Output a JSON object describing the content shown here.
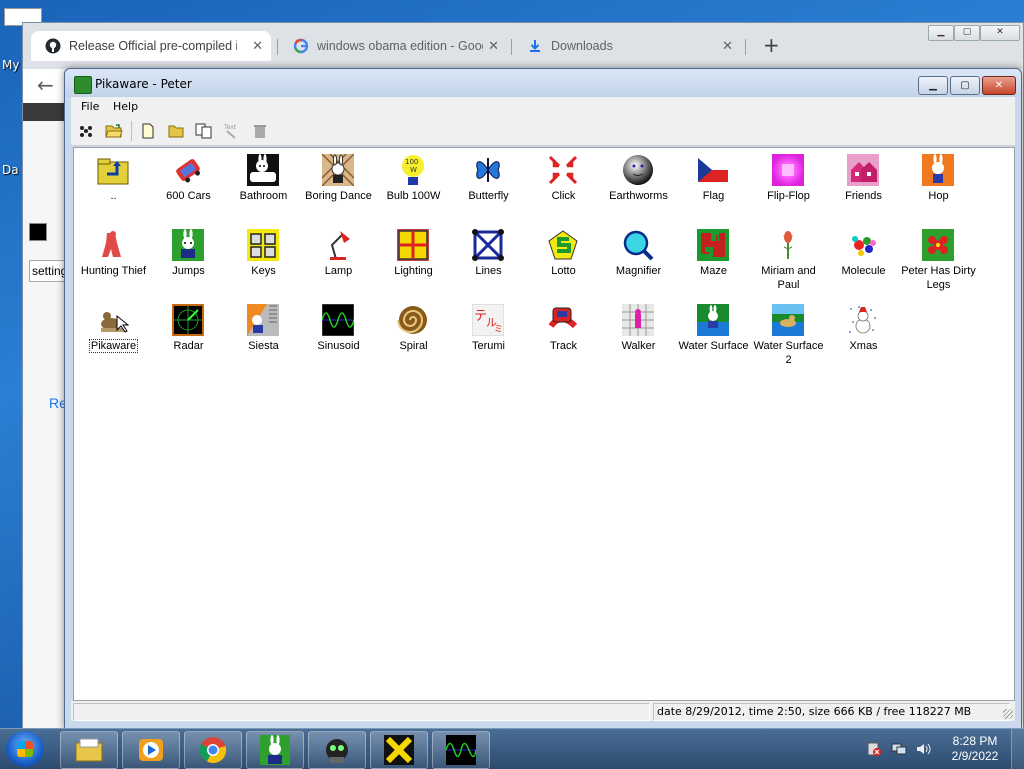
{
  "desktop": {
    "label_my": "My",
    "label_da": "Da"
  },
  "chrome": {
    "tabs": [
      {
        "title": "Release Official pre-compiled ins",
        "icon": "github-icon",
        "active": true
      },
      {
        "title": "windows obama edition - Google",
        "icon": "google-icon",
        "active": false
      },
      {
        "title": "Downloads",
        "icon": "download-icon",
        "active": false
      }
    ],
    "behind_input_value": "setting",
    "behind_link_text": "Re"
  },
  "pikaware": {
    "window_title": "Pikaware - Peter",
    "menu": [
      "File",
      "Help"
    ],
    "toolbar": [
      {
        "name": "multimedia-icon",
        "enabled": true
      },
      {
        "name": "open-folder-icon",
        "enabled": true
      },
      {
        "name": "new-file-icon",
        "enabled": true
      },
      {
        "name": "new-folder-icon",
        "enabled": true
      },
      {
        "name": "copy-icon",
        "enabled": true
      },
      {
        "name": "text-tool-icon",
        "enabled": false
      },
      {
        "name": "delete-icon",
        "enabled": false
      }
    ],
    "items": [
      {
        "label": "..",
        "icon": "parent-folder-icon"
      },
      {
        "label": "600 Cars",
        "icon": "cars-icon"
      },
      {
        "label": "Bathroom",
        "icon": "bathroom-icon"
      },
      {
        "label": "Boring Dance",
        "icon": "boring-dance-icon"
      },
      {
        "label": "Bulb 100W",
        "icon": "bulb-icon"
      },
      {
        "label": "Butterfly",
        "icon": "butterfly-icon"
      },
      {
        "label": "Click",
        "icon": "click-icon"
      },
      {
        "label": "Earthworms",
        "icon": "earthworms-icon"
      },
      {
        "label": "Flag",
        "icon": "flag-icon"
      },
      {
        "label": "Flip-Flop",
        "icon": "flip-flop-icon"
      },
      {
        "label": "Friends",
        "icon": "friends-icon"
      },
      {
        "label": "Hop",
        "icon": "hop-icon"
      },
      {
        "label": "Hunting Thief",
        "icon": "hunting-thief-icon"
      },
      {
        "label": "Jumps",
        "icon": "jumps-icon"
      },
      {
        "label": "Keys",
        "icon": "keys-icon"
      },
      {
        "label": "Lamp",
        "icon": "lamp-icon"
      },
      {
        "label": "Lighting",
        "icon": "lighting-icon"
      },
      {
        "label": "Lines",
        "icon": "lines-icon"
      },
      {
        "label": "Lotto",
        "icon": "lotto-icon"
      },
      {
        "label": "Magnifier",
        "icon": "magnifier-icon"
      },
      {
        "label": "Maze",
        "icon": "maze-icon"
      },
      {
        "label": "Miriam and Paul",
        "icon": "miriam-paul-icon"
      },
      {
        "label": "Molecule",
        "icon": "molecule-icon"
      },
      {
        "label": "Peter Has Dirty Legs",
        "icon": "peter-dirty-legs-icon"
      },
      {
        "label": "Pikaware",
        "icon": "pikaware-icon",
        "selected": true
      },
      {
        "label": "Radar",
        "icon": "radar-icon"
      },
      {
        "label": "Siesta",
        "icon": "siesta-icon"
      },
      {
        "label": "Sinusoid",
        "icon": "sinusoid-icon"
      },
      {
        "label": "Spiral",
        "icon": "spiral-icon"
      },
      {
        "label": "Terumi",
        "icon": "terumi-icon"
      },
      {
        "label": "Track",
        "icon": "track-icon"
      },
      {
        "label": "Walker",
        "icon": "walker-icon"
      },
      {
        "label": "Water Surface",
        "icon": "water-surface-icon"
      },
      {
        "label": "Water Surface 2",
        "icon": "water-surface-2-icon"
      },
      {
        "label": "Xmas",
        "icon": "xmas-icon"
      }
    ],
    "status": "date 8/29/2012, time 2:50, size 666 KB / free 118227 MB"
  },
  "taskbar": {
    "buttons": [
      {
        "name": "explorer-icon"
      },
      {
        "name": "media-player-icon"
      },
      {
        "name": "chrome-icon"
      },
      {
        "name": "pikaware-rabbit-icon"
      },
      {
        "name": "alien-icon"
      },
      {
        "name": "x-app-icon"
      },
      {
        "name": "sinusoid-app-icon"
      }
    ],
    "time": "8:28 PM",
    "date": "2/9/2022"
  }
}
